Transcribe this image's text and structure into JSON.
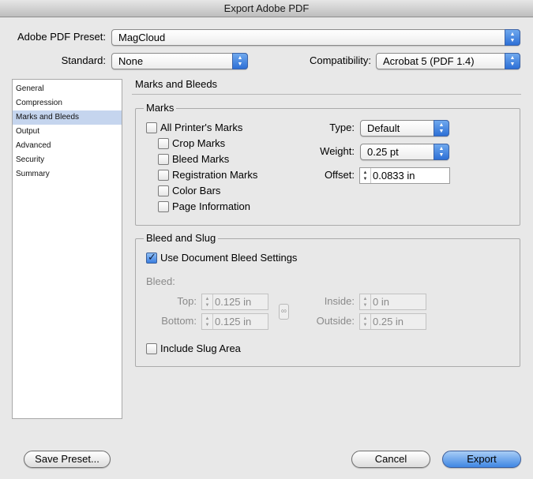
{
  "window": {
    "title": "Export Adobe PDF"
  },
  "header": {
    "preset_label": "Adobe PDF Preset:",
    "preset_value": "MagCloud",
    "standard_label": "Standard:",
    "standard_value": "None",
    "compat_label": "Compatibility:",
    "compat_value": "Acrobat 5 (PDF 1.4)"
  },
  "sidebar": {
    "items": [
      {
        "label": "General"
      },
      {
        "label": "Compression"
      },
      {
        "label": "Marks and Bleeds",
        "selected": true
      },
      {
        "label": "Output"
      },
      {
        "label": "Advanced"
      },
      {
        "label": "Security"
      },
      {
        "label": "Summary"
      }
    ]
  },
  "main": {
    "title": "Marks and Bleeds",
    "marks": {
      "group_title": "Marks",
      "all_printers": {
        "label": "All Printer's Marks",
        "checked": false
      },
      "crop": {
        "label": "Crop Marks",
        "checked": false
      },
      "bleed": {
        "label": "Bleed Marks",
        "checked": false
      },
      "registration": {
        "label": "Registration Marks",
        "checked": false
      },
      "color_bars": {
        "label": "Color Bars",
        "checked": false
      },
      "page_info": {
        "label": "Page Information",
        "checked": false
      },
      "type_label": "Type:",
      "type_value": "Default",
      "weight_label": "Weight:",
      "weight_value": "0.25 pt",
      "offset_label": "Offset:",
      "offset_value": "0.0833 in"
    },
    "bleed": {
      "group_title": "Bleed and Slug",
      "use_doc": {
        "label": "Use Document Bleed Settings",
        "checked": true
      },
      "bleed_label": "Bleed:",
      "top_label": "Top:",
      "top_value": "0.125 in",
      "bottom_label": "Bottom:",
      "bottom_value": "0.125 in",
      "inside_label": "Inside:",
      "inside_value": "0 in",
      "outside_label": "Outside:",
      "outside_value": "0.25 in",
      "slug": {
        "label": "Include Slug Area",
        "checked": false
      }
    }
  },
  "footer": {
    "save_preset": "Save Preset...",
    "cancel": "Cancel",
    "export": "Export"
  }
}
